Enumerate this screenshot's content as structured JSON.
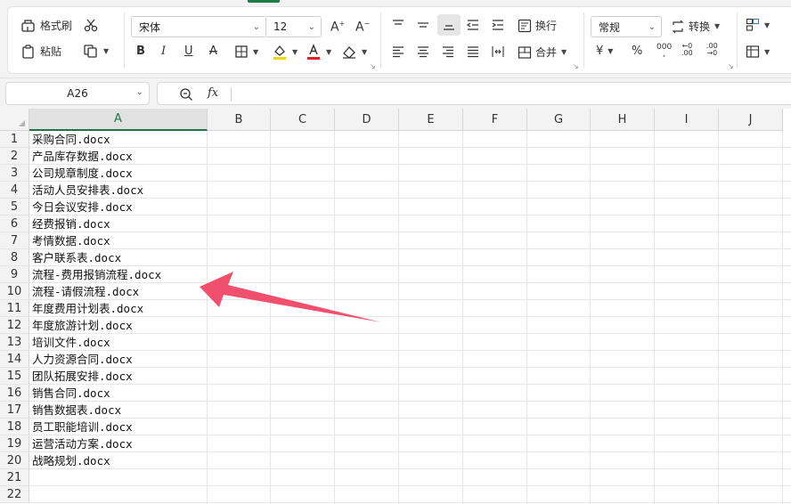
{
  "ribbon": {
    "format_painter_label": "格式刷",
    "paste_label": "粘贴",
    "font_name": "宋体",
    "font_size": "12",
    "wrap_label": "换行",
    "merge_label": "合并",
    "number_format": "常规",
    "convert_label": "转换",
    "currency_symbol": "¥",
    "percent_symbol": "%"
  },
  "formula_bar": {
    "cell_ref": "A26",
    "fx_label": "fx",
    "formula": ""
  },
  "sheet": {
    "columns": [
      "A",
      "B",
      "C",
      "D",
      "E",
      "F",
      "G",
      "H",
      "I",
      "J"
    ],
    "selected_column": "A",
    "row_numbers": [
      "1",
      "2",
      "3",
      "4",
      "5",
      "6",
      "7",
      "8",
      "9",
      "10",
      "11",
      "12",
      "13",
      "14",
      "15",
      "16",
      "17",
      "18",
      "19",
      "20",
      "21",
      "22"
    ],
    "cells": [
      "采购合同.docx",
      "产品库存数据.docx",
      "公司规章制度.docx",
      "活动人员安排表.docx",
      "今日会议安排.docx",
      "经费报销.docx",
      "考情数据.docx",
      "客户联系表.docx",
      "流程-费用报销流程.docx",
      "流程-请假流程.docx",
      "年度费用计划表.docx",
      "年度旅游计划.docx",
      "培训文件.docx",
      "人力资源合同.docx",
      "团队拓展安排.docx",
      "销售合同.docx",
      "销售数据表.docx",
      "员工职能培训.docx",
      "运营活动方案.docx",
      "战略规划.docx"
    ]
  },
  "colors": {
    "accent_green": "#217346",
    "arrow_red": "#f0506e",
    "fill_yellow": "#f2d400",
    "font_red": "#e02020"
  },
  "icons": [
    "format-painter-icon",
    "cut-icon",
    "paste-icon",
    "copy-icon",
    "bold-icon",
    "italic-icon",
    "underline-icon",
    "strikethrough-icon",
    "border-icon",
    "fill-color-icon",
    "font-color-icon",
    "eraser-icon",
    "wrap-text-icon",
    "merge-icon",
    "zoom-icon",
    "annotation-arrow"
  ]
}
